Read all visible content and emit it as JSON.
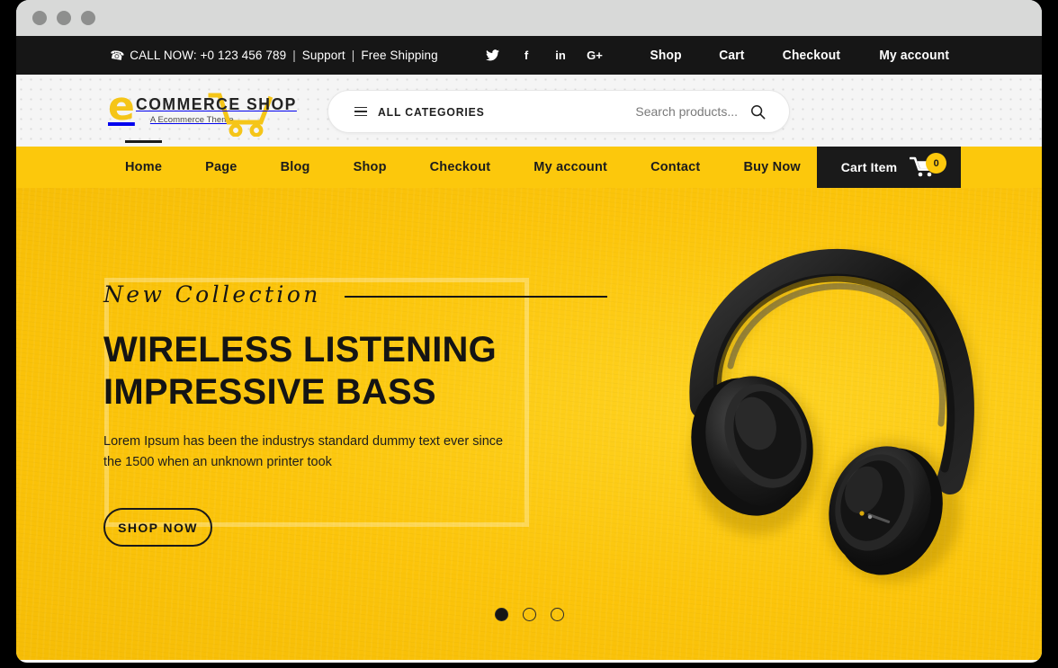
{
  "window": {
    "buttons": [
      "close",
      "minimize",
      "maximize"
    ]
  },
  "topbar": {
    "phone_icon": "phone-icon",
    "call_text": "CALL NOW: +0 123 456 789",
    "separator": "|",
    "support_label": "Support",
    "shipping_label": "Free Shipping",
    "socials": [
      {
        "name": "twitter",
        "glyph": "twitter-icon"
      },
      {
        "name": "facebook",
        "glyph": "f"
      },
      {
        "name": "linkedin",
        "glyph": "in"
      },
      {
        "name": "googleplus",
        "glyph": "G+"
      }
    ],
    "links": [
      {
        "label": "Shop"
      },
      {
        "label": "Cart"
      },
      {
        "label": "Checkout"
      },
      {
        "label": "My account"
      }
    ]
  },
  "header": {
    "logo": {
      "initial": "e",
      "main": "COMMERCE SHOP",
      "tagline": "A Ecommerce Theme"
    },
    "search": {
      "categories_label": "ALL CATEGORIES",
      "placeholder": "Search products...",
      "value": "",
      "search_icon": "search-icon",
      "menu_icon": "hamburger-icon"
    }
  },
  "mainnav": {
    "items": [
      {
        "label": "Home",
        "active": true
      },
      {
        "label": "Page",
        "active": false
      },
      {
        "label": "Blog",
        "active": false
      },
      {
        "label": "Shop",
        "active": false
      },
      {
        "label": "Checkout",
        "active": false
      },
      {
        "label": "My account",
        "active": false
      },
      {
        "label": "Contact",
        "active": false
      },
      {
        "label": "Buy Now",
        "active": false
      }
    ],
    "cart": {
      "label": "Cart Item",
      "count": "0",
      "icon": "cart-icon"
    }
  },
  "hero": {
    "eyebrow": "New Collection",
    "title_line1": "WIRELESS LISTENING",
    "title_line2": "IMPRESSIVE BASS",
    "description": "Lorem Ipsum has been the industrys standard dummy text ever since the 1500 when an unknown printer took",
    "cta_label": "SHOP NOW",
    "image_alt": "black-over-ear-headphones",
    "slides": [
      {
        "index": "1",
        "active": true
      },
      {
        "index": "2",
        "active": false
      },
      {
        "index": "3",
        "active": false
      }
    ]
  },
  "colors": {
    "accent_yellow": "#fcc80c",
    "hero_yellow": "#fdcd14",
    "dark": "#1a1a1a",
    "topbar_dark": "#161616",
    "header_gray": "#f5f5f5",
    "titlebar_gray": "#d8d9d8",
    "logo_yellow": "#f5c518"
  }
}
